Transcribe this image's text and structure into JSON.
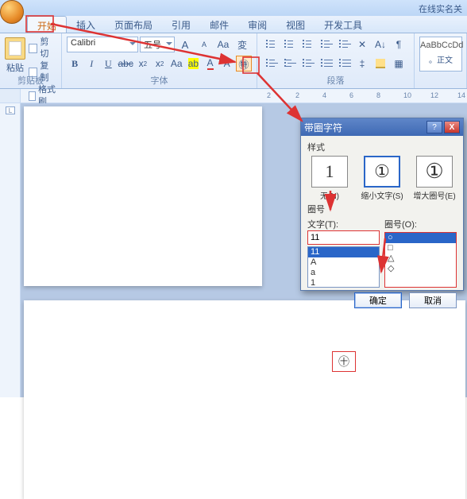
{
  "titlebar": {
    "right_status": "在线实名关"
  },
  "tabs": [
    "开始",
    "插入",
    "页面布局",
    "引用",
    "邮件",
    "审阅",
    "视图",
    "开发工具"
  ],
  "ribbon": {
    "clipboard": {
      "paste": "粘贴",
      "cut": "剪切",
      "copy": "复制",
      "format_painter": "格式刷",
      "label": "剪贴板"
    },
    "font": {
      "name": "Calibri",
      "size": "五号",
      "grow": "A",
      "shrink": "A",
      "clear": "Aa",
      "b": "B",
      "i": "I",
      "u": "U",
      "strike": "abc",
      "sub": "x",
      "sup": "x",
      "case": "Aa",
      "highlight": "ab",
      "color": "A",
      "enclose": "㊕",
      "label": "字体"
    },
    "paragraph": {
      "label": "段落"
    },
    "styles": {
      "sample": "AaBbCcDd",
      "name": "。正文"
    }
  },
  "ruler": {
    "vruler_mark": "L"
  },
  "page2": {
    "enclosed_symbol": "㊉"
  },
  "dialog": {
    "title": "带圈字符",
    "help": "?",
    "close": "X",
    "style_label": "样式",
    "styles": {
      "none": {
        "glyph": "1",
        "cap": "无(N)"
      },
      "shrink": {
        "glyph": "①",
        "cap": "缩小文字(S)"
      },
      "enlarge": {
        "glyph": "①",
        "cap": "增大圈号(E)"
      }
    },
    "ring_label": "圈号",
    "text_label": "文字(T):",
    "ring_col_label": "圈号(O):",
    "text_value": "11",
    "text_list": [
      "11",
      "A",
      "a",
      "1"
    ],
    "ring_list": [
      "○",
      "□",
      "△",
      "◇"
    ],
    "ok": "确定",
    "cancel": "取消"
  }
}
